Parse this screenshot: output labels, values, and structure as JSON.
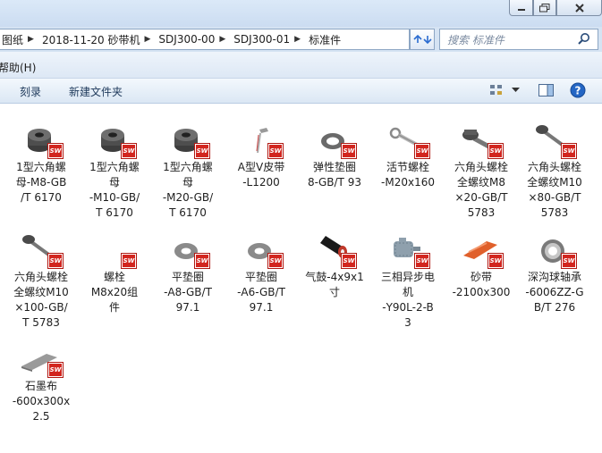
{
  "window": {
    "minimize_icon": "minimize-icon",
    "maximize_icon": "maximize-icon",
    "close_icon": "close-icon"
  },
  "address_bar": {
    "crumbs": [
      "图纸",
      "2018-11-20 砂带机",
      "SDJ300-00",
      "SDJ300-01",
      "标准件"
    ]
  },
  "search": {
    "placeholder": "搜索 标准件"
  },
  "menu": {
    "help": "帮助(H)"
  },
  "toolbar": {
    "burn": "刻录",
    "new_folder": "新建文件夹"
  },
  "sw_badge": "SW",
  "files": [
    {
      "label": "1型六角螺\n母-M8-GB\n/T 6170",
      "icon": "hex-nut"
    },
    {
      "label": "1型六角螺\n母\n-M10-GB/\nT 6170",
      "icon": "hex-nut"
    },
    {
      "label": "1型六角螺\n母\n-M20-GB/\nT 6170",
      "icon": "hex-nut"
    },
    {
      "label": "A型V皮带\n-L1200",
      "icon": "v-belt"
    },
    {
      "label": "弹性垫圈\n8-GB/T 93",
      "icon": "spring-washer"
    },
    {
      "label": "活节螺栓\n-M20x160",
      "icon": "eye-bolt"
    },
    {
      "label": "六角头螺栓\n全螺纹M8\n×20-GB/T\n5783",
      "icon": "hex-bolt"
    },
    {
      "label": "六角头螺栓\n全螺纹M10\n×80-GB/T\n5783",
      "icon": "long-bolt"
    },
    {
      "label": "六角头螺栓\n全螺纹M10\n×100-GB/\nT 5783",
      "icon": "long-bolt"
    },
    {
      "label": "螺栓\nM8x20组\n件",
      "icon": "blank"
    },
    {
      "label": "平垫圈\n-A8-GB/T\n97.1",
      "icon": "flat-washer"
    },
    {
      "label": "平垫圈\n-A6-GB/T\n97.1",
      "icon": "flat-washer"
    },
    {
      "label": "气鼓-4x9x1\n寸",
      "icon": "drum"
    },
    {
      "label": "三相异步电\n机\n-Y90L-2-B\n3",
      "icon": "motor"
    },
    {
      "label": "砂带\n-2100x300",
      "icon": "sand-belt"
    },
    {
      "label": "深沟球轴承\n-6006ZZ-G\nB/T 276",
      "icon": "bearing"
    },
    {
      "label": "石墨布\n-600x300x\n2.5",
      "icon": "graphite-cloth"
    }
  ]
}
